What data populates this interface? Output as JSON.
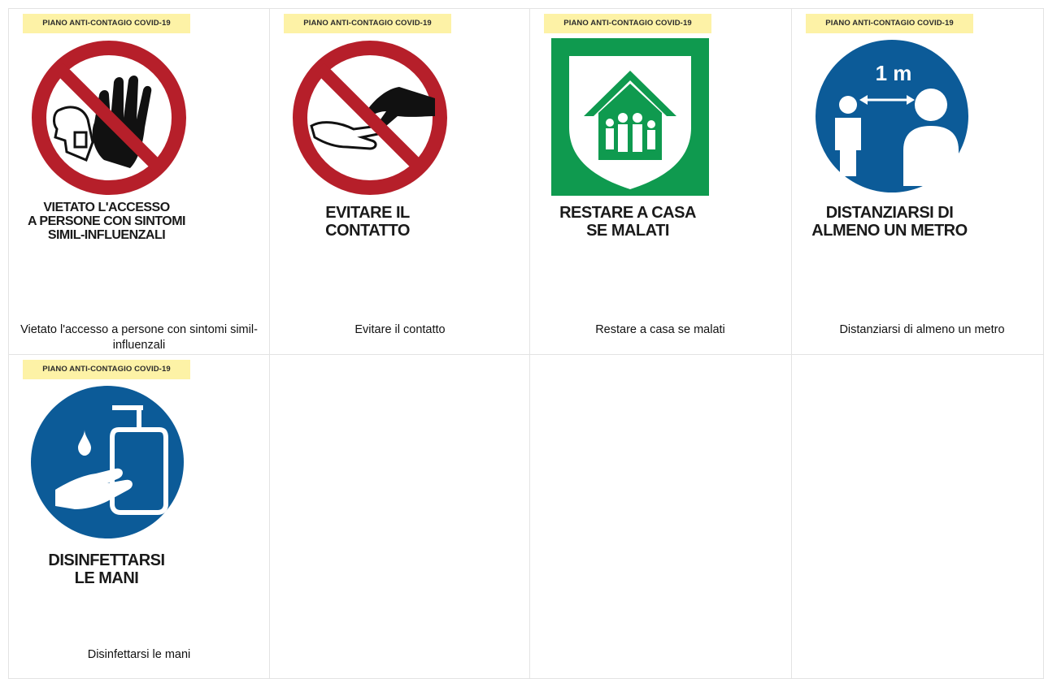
{
  "signs": [
    {
      "tag": "PIANO ANTI-CONTAGIO COVID-19",
      "title": "VIETATO L'ACCESSO\nA PERSONE CON SINTOMI\nSIMIL-INFLUENZALI",
      "caption": "Vietato l'accesso a persone con sintomi simil-influenzali",
      "icon": "stop-hand-icon"
    },
    {
      "tag": "PIANO ANTI-CONTAGIO COVID-19",
      "title": "EVITARE IL\nCONTATTO",
      "caption": "Evitare il contatto",
      "icon": "handshake-prohibited-icon"
    },
    {
      "tag": "PIANO ANTI-CONTAGIO COVID-19",
      "title": "RESTARE A CASA\nSE MALATI",
      "caption": "Restare a casa se malati",
      "icon": "house-family-icon"
    },
    {
      "tag": "PIANO ANTI-CONTAGIO COVID-19",
      "title": "DISTANZIARSI DI\nALMENO UN METRO",
      "caption": "Distanziarsi di almeno un metro",
      "icon": "social-distance-icon",
      "distance_label": "1 m"
    },
    {
      "tag": "PIANO ANTI-CONTAGIO COVID-19",
      "title": "DISINFETTARSI\nLE MANI",
      "caption": "Disinfettarsi le mani",
      "icon": "hand-sanitizer-icon"
    }
  ],
  "colors": {
    "prohibition_red": "#b61f2a",
    "safety_green": "#0f9a4f",
    "mandatory_blue": "#0c5b98",
    "tag_yellow": "#fdf2a6"
  }
}
